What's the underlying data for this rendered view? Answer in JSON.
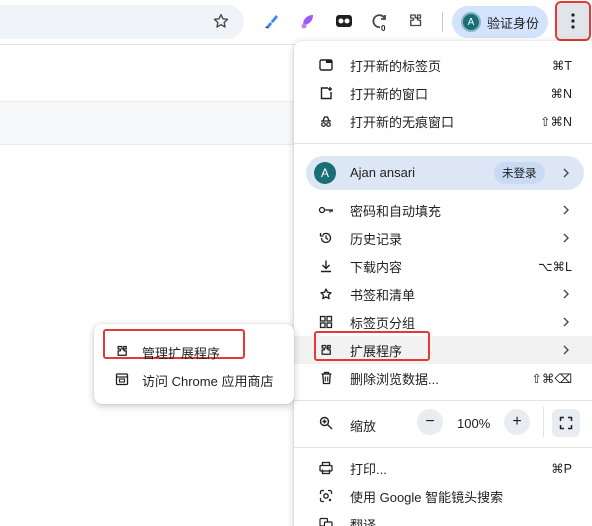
{
  "toolbar": {
    "star_icon": "star-icon",
    "extension_badge": "0",
    "profile_chip_avatar": "A",
    "profile_chip_label": "验证身份",
    "menu_icon": "three-dot-menu-icon"
  },
  "menu": {
    "items_top": [
      {
        "label": "打开新的标签页",
        "shortcut": "⌘T",
        "icon": "new-tab-icon"
      },
      {
        "label": "打开新的窗口",
        "shortcut": "⌘N",
        "icon": "new-window-icon"
      },
      {
        "label": "打开新的无痕窗口",
        "shortcut": "⇧⌘N",
        "icon": "incognito-icon"
      }
    ],
    "profile": {
      "avatar": "A",
      "name": "Ajan ansari",
      "status": "未登录"
    },
    "items_mid": [
      {
        "label": "密码和自动填充",
        "icon": "key-icon"
      },
      {
        "label": "历史记录",
        "icon": "history-icon"
      },
      {
        "label": "下载内容",
        "shortcut": "⌥⌘L",
        "icon": "download-icon"
      },
      {
        "label": "书签和清单",
        "icon": "star-icon"
      },
      {
        "label": "标签页分组",
        "icon": "grid-icon"
      },
      {
        "label": "扩展程序",
        "icon": "puzzle-icon"
      },
      {
        "label": "删除浏览数据...",
        "shortcut": "⇧⌘⌫",
        "icon": "trash-icon"
      }
    ],
    "zoom": {
      "label": "缩放",
      "minus": "−",
      "value": "100%",
      "plus": "+"
    },
    "items_bottom": [
      {
        "label": "打印...",
        "shortcut": "⌘P",
        "icon": "print-icon"
      },
      {
        "label": "使用 Google 智能镜头搜索",
        "icon": "lens-icon"
      },
      {
        "label": "翻译...",
        "icon": "translate-icon"
      }
    ]
  },
  "submenu": {
    "items": [
      {
        "label": "管理扩展程序",
        "icon": "puzzle-icon"
      },
      {
        "label": "访问 Chrome 应用商店",
        "icon": "webstore-icon"
      }
    ]
  },
  "colors": {
    "highlight_border": "#e53935",
    "profile_row_bg": "#dde6f5",
    "chip_bg": "#d3e3fd",
    "avatar_bg": "#1a6e75"
  }
}
